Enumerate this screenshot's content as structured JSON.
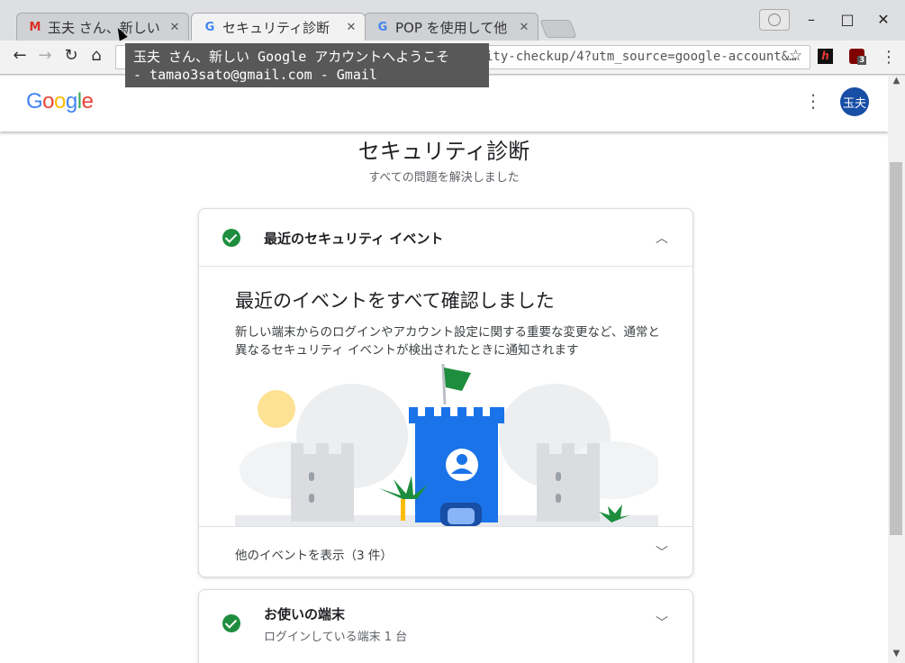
{
  "browser": {
    "tabs": [
      {
        "title": "玉夫 さん、新しい",
        "favicon": "gmail-icon"
      },
      {
        "title": "セキュリティ診断",
        "favicon": "google-g-icon",
        "active": true
      },
      {
        "title": "POP を使用して他",
        "favicon": "google-g-icon"
      }
    ],
    "url": "ity-checkup/4?utm_source=google-account&…",
    "tooltip": "玉夫 さん、新しい Google アカウントへようこそ\n- tamao3sato@gmail.com - Gmail",
    "extension_badge": "3"
  },
  "app": {
    "logo": "Google",
    "avatar_text": "玉夫"
  },
  "page": {
    "title": "セキュリティ診断",
    "subtitle": "すべての問題を解決しました"
  },
  "section_events": {
    "title": "最近のセキュリティ イベント",
    "headline": "最近のイベントをすべて確認しました",
    "description": "新しい端末からのログインやアカウント設定に関する重要な変更など、通常と異なるセキュリティ イベントが検出されたときに通知されます",
    "more_link": "他のイベントを表示（3 件）"
  },
  "section_devices": {
    "title": "お使いの端末",
    "subtitle": "ログインしている端末 1 台"
  },
  "colors": {
    "accent_blue": "#1a73e8",
    "success_green": "#1e8e3e",
    "avatar_bg": "#174ea6"
  }
}
